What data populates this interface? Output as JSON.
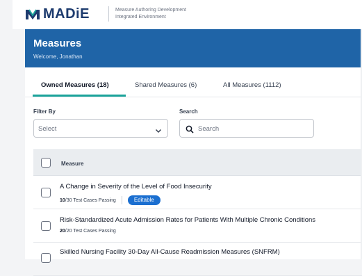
{
  "app": {
    "logo_text": "MADiE",
    "tagline_line1": "Measure Authoring Development",
    "tagline_line2": "Integrated Environment"
  },
  "header": {
    "title": "Measures",
    "welcome": "Welcome, Jonathan"
  },
  "tabs": [
    {
      "label": "Owned Measures (18)",
      "active": true
    },
    {
      "label": "Shared Measures (6)",
      "active": false
    },
    {
      "label": "All Measures (1112)",
      "active": false
    }
  ],
  "filter": {
    "label": "Filter By",
    "value": "Select"
  },
  "search": {
    "label": "Search",
    "placeholder": "Search"
  },
  "table": {
    "column_header": "Measure",
    "rows": [
      {
        "name": "A Change in Severity of the Level of Food Insecurity",
        "passing": "10",
        "total_text": "/30 Test Cases Passing",
        "badge": "Editable"
      },
      {
        "name": "Risk-Standardized Acute Admission Rates for Patients With Multiple Chronic Conditions",
        "passing": "20",
        "total_text": "/20 Test Cases Passing"
      },
      {
        "name": "Skilled Nursing Facility 30-Day All-Cause Readmission Measures (SNFRM)"
      }
    ]
  },
  "colors": {
    "brand_navy": "#1d3b6e",
    "header_blue": "#1f64a7",
    "tab_accent": "#1aa39a",
    "badge_blue": "#1b6fd0"
  },
  "icons": [
    "madie-logo-icon",
    "chevron-down-icon",
    "search-icon"
  ]
}
